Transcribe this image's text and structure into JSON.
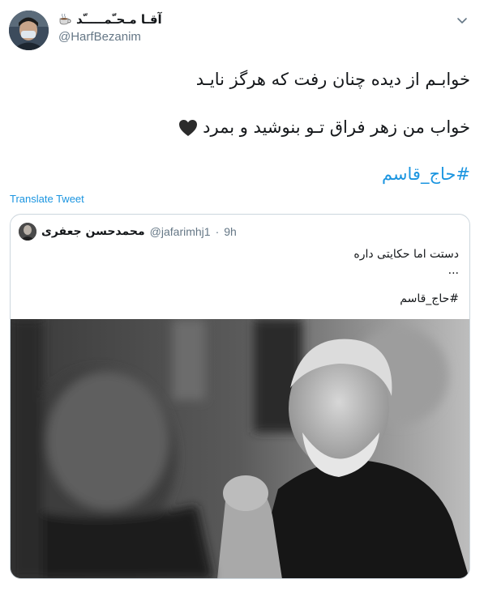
{
  "tweet": {
    "author": {
      "display_name": "آقـا مـحـّمـــــّد",
      "handle": "@HarfBezanim",
      "name_emoji": "hot-beverage-icon"
    },
    "text_line_1": "خوابـم از دیده چنان رفت که هرگز نایـد",
    "text_line_2": "خواب من زهر فراق تـو بنوشید و بمرد",
    "text_line_2_emoji": "black-heart-icon",
    "hashtag": "#حاج_قاسم",
    "translate_label": "Translate Tweet",
    "menu_icon": "chevron-down-icon"
  },
  "quoted_tweet": {
    "display_name": "محمدحسن جعفری",
    "handle": "@jafarimhj1",
    "separator": "·",
    "time": "9h",
    "text_line_1": "دستت اما حکایتی داره",
    "text_line_2": "...",
    "hashtag": "#حاج_قاسم"
  },
  "colors": {
    "link": "#1b95e0",
    "secondary_text": "#657786",
    "border": "#ccd6dd"
  }
}
